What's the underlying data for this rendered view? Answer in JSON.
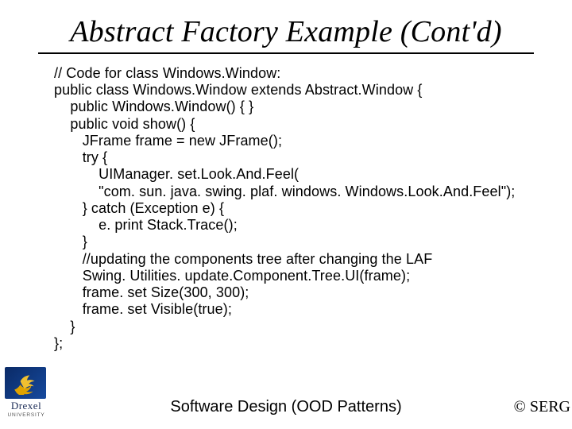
{
  "title": "Abstract Factory Example (Cont'd)",
  "code": "// Code for class Windows.Window:\npublic class Windows.Window extends Abstract.Window {\n    public Windows.Window() { }\n    public void show() {\n       JFrame frame = new JFrame();\n       try {\n           UIManager. set.Look.And.Feel(\n           \"com. sun. java. swing. plaf. windows. Windows.Look.And.Feel\");\n       } catch (Exception e) {\n           e. print Stack.Trace();\n       }\n       //updating the components tree after changing the LAF\n       Swing. Utilities. update.Component.Tree.UI(frame);\n       frame. set Size(300, 300);\n       frame. set Visible(true);\n    }\n};",
  "logo": {
    "name": "Drexel",
    "sub": "UNIVERSITY"
  },
  "footer_center": "Software Design (OOD Patterns)",
  "footer_right": "© SERG"
}
